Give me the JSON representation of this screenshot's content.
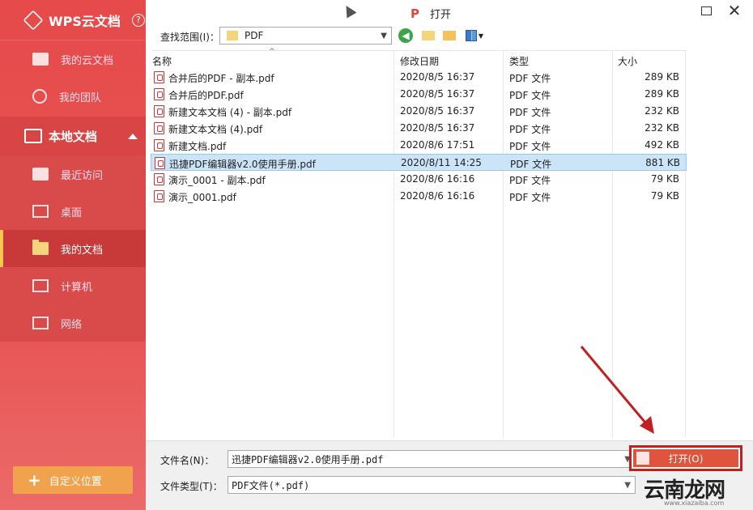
{
  "sidebar": {
    "brand": "WPS云文档",
    "help": "?",
    "items_top": [
      {
        "label": "我的云文档",
        "icon": "cloud-folder-icon"
      },
      {
        "label": "我的团队",
        "icon": "team-icon"
      }
    ],
    "section": {
      "label": "本地文档",
      "icon": "monitor-icon"
    },
    "items_local": [
      {
        "label": "最近访问",
        "icon": "recent-folder-icon"
      },
      {
        "label": "桌面",
        "icon": "desktop-icon"
      },
      {
        "label": "我的文档",
        "icon": "folder-icon",
        "active": true
      },
      {
        "label": "计算机",
        "icon": "computer-icon"
      },
      {
        "label": "网络",
        "icon": "network-icon"
      }
    ],
    "custom_location": "自定义位置"
  },
  "dialog": {
    "title": "打开",
    "lookin_label": "查找范围(I)：",
    "lookin_value": "PDF",
    "columns": {
      "name": "名称",
      "date": "修改日期",
      "type": "类型",
      "size": "大小"
    },
    "files": [
      {
        "name": "合并后的PDF - 副本.pdf",
        "date": "2020/8/5 16:37",
        "type": "PDF 文件",
        "size": "289 KB"
      },
      {
        "name": "合并后的PDF.pdf",
        "date": "2020/8/5 16:37",
        "type": "PDF 文件",
        "size": "289 KB"
      },
      {
        "name": "新建文本文档 (4) - 副本.pdf",
        "date": "2020/8/5 16:37",
        "type": "PDF 文件",
        "size": "232 KB"
      },
      {
        "name": "新建文本文档 (4).pdf",
        "date": "2020/8/5 16:37",
        "type": "PDF 文件",
        "size": "232 KB"
      },
      {
        "name": "新建文档.pdf",
        "date": "2020/8/6 17:51",
        "type": "PDF 文件",
        "size": "492 KB"
      },
      {
        "name": "迅捷PDF编辑器v2.0使用手册.pdf",
        "date": "2020/8/11 14:25",
        "type": "PDF 文件",
        "size": "881 KB",
        "selected": true
      },
      {
        "name": "演示_0001 - 副本.pdf",
        "date": "2020/8/6 16:16",
        "type": "PDF 文件",
        "size": "79 KB"
      },
      {
        "name": "演示_0001.pdf",
        "date": "2020/8/6 16:16",
        "type": "PDF 文件",
        "size": "79 KB"
      }
    ],
    "filename_label": "文件名(N)：",
    "filename_value": "迅捷PDF编辑器v2.0使用手册.pdf",
    "filetype_label": "文件类型(T)：",
    "filetype_value": "PDF文件(*.pdf)",
    "open_button": "打开(O)"
  },
  "watermark": {
    "text": "云南龙网",
    "url": "www.xiazaiba.com"
  },
  "colors": {
    "sidebar": "#e64a4a",
    "accent": "#f0a24c",
    "selection": "#cce4f7",
    "annotation": "#c0201f"
  }
}
